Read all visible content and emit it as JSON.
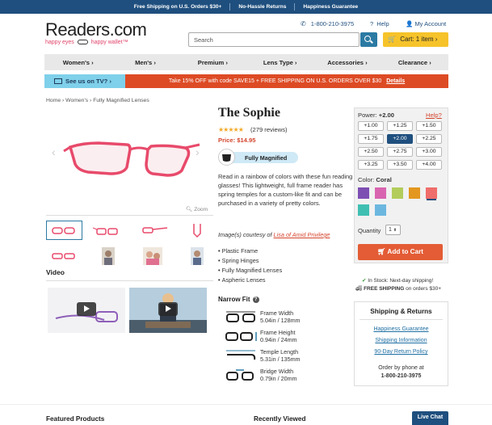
{
  "topbar": {
    "items": [
      "Free Shipping on U.S. Orders $30+",
      "No-Hassle Returns",
      "Happiness Guarantee"
    ]
  },
  "header": {
    "logo": "Readers.com",
    "tagline_left": "happy eyes",
    "tagline_right": "happy wallet™",
    "phone": "1-800-210-3975",
    "help": "Help",
    "account": "My Account",
    "search_placeholder": "Search",
    "cart": "Cart: 1 item ›"
  },
  "nav": {
    "items": [
      "Women's ›",
      "Men's ›",
      "Premium ›",
      "Lens Type ›",
      "Accessories ›",
      "Clearance ›"
    ]
  },
  "promo": {
    "tv": "See us on TV? ›",
    "offer": "Take 15% OFF with code SAVE15 + FREE SHIPPING ON U.S. ORDERS OVER $30",
    "details": "Details"
  },
  "breadcrumb": "Home › Women's › Fully Magnified Lenses",
  "gallery": {
    "zoom": "Zoom",
    "video_heading": "Video"
  },
  "product": {
    "name": "The Sophie",
    "stars": "★★★★★",
    "reviews": "(279 reviews)",
    "price": "Price: $14.95",
    "lens_type": "Fully Magnified",
    "description": "Read in a rainbow of colors with these fun reading glasses! This lightweight, full frame reader has spring temples for a custom-like fit and can be purchased in a variety of pretty colors.",
    "credit_prefix": "Image(s) courtesy of ",
    "credit_link": "Lisa of Amid Privilege",
    "features": [
      "Plastic Frame",
      "Spring Hinges",
      "Fully Magnified Lenses",
      "Aspheric Lenses"
    ],
    "fit_title": "Narrow Fit",
    "measurements": [
      {
        "name": "Frame Width",
        "value": "5.04in / 128mm"
      },
      {
        "name": "Frame Height",
        "value": "0.94in / 24mm"
      },
      {
        "name": "Temple Length",
        "value": "5.31in / 135mm"
      },
      {
        "name": "Bridge Width",
        "value": "0.79in / 20mm"
      }
    ]
  },
  "options": {
    "power_label": "Power:",
    "power_value": "+2.00",
    "help": "Help?",
    "powers": [
      "+1.00",
      "+1.25",
      "+1.50",
      "+1.75",
      "+2.00",
      "+2.25",
      "+2.50",
      "+2.75",
      "+3.00",
      "+3.25",
      "+3.50",
      "+4.00"
    ],
    "selected_power": "+2.00",
    "color_label": "Color:",
    "color_value": "Coral",
    "swatches": [
      "#7d4fb3",
      "#d864b0",
      "#b3cd5c",
      "#e3971f",
      "#ef6d6a",
      "#3fbfb2",
      "#6cb7e0"
    ],
    "selected_swatch": 4,
    "qty_label": "Quantity",
    "qty_value": "1",
    "add_to_cart": "Add to Cart",
    "stock": "In Stock: Next-day shipping!",
    "shipping_bold": "FREE SHIPPING",
    "shipping_rest": " on orders $30+"
  },
  "returns": {
    "title": "Shipping & Returns",
    "links": [
      "Happiness Guarantee",
      "Shipping Information",
      "90-Day Return Policy"
    ],
    "order_line": "Order by phone at",
    "phone": "1-800-210-3975"
  },
  "footer": {
    "featured": "Featured Products",
    "recent": "Recently Viewed",
    "chat": "Live Chat"
  },
  "colors": {
    "navy": "#1f4f7e",
    "promo_red": "#dd4b25",
    "accent_red": "#d4442c",
    "cart_yellow": "#f6c32a",
    "frame_pink": "#e84a6b"
  }
}
